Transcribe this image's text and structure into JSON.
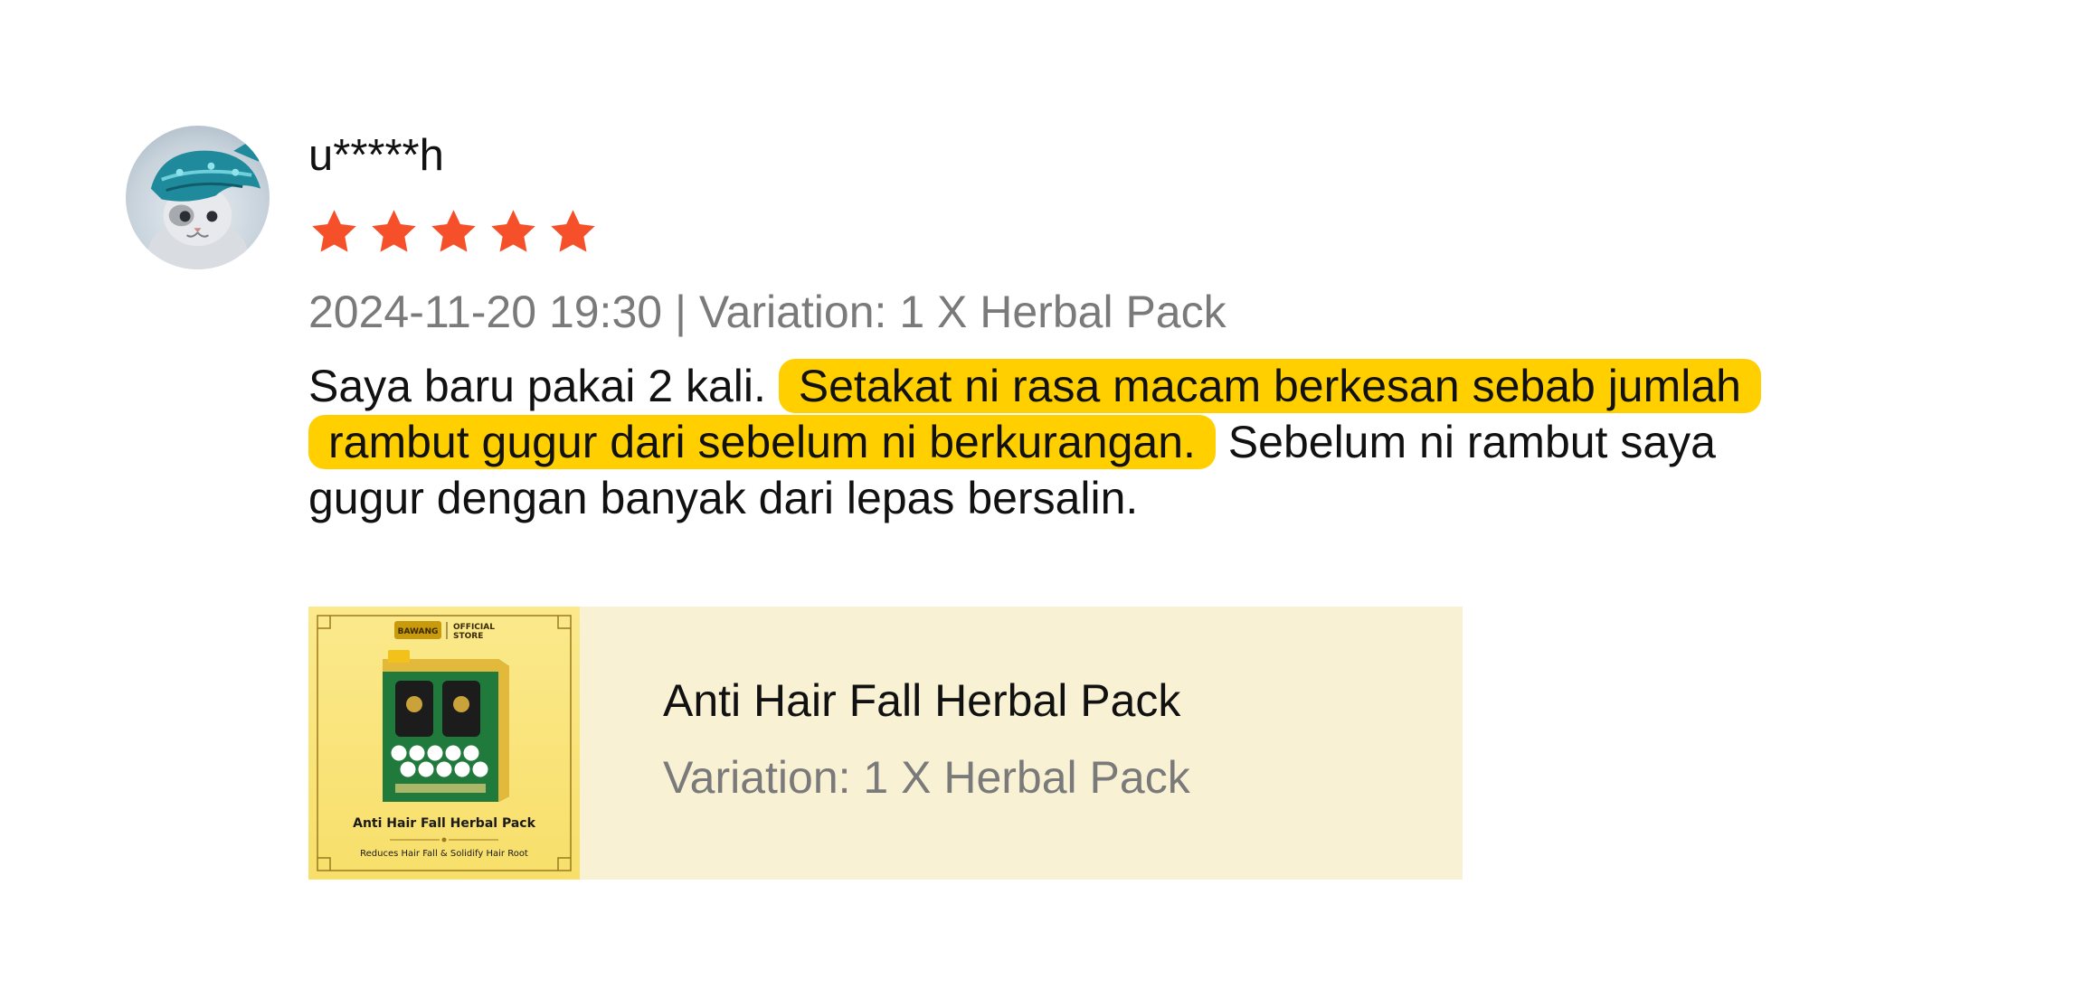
{
  "review": {
    "username": "u*****h",
    "rating": 5,
    "rating_max": 5,
    "star_color": "#f5502a",
    "date": "2024-11-20 19:30",
    "separator": "|",
    "variation_label": "Variation:",
    "variation_value": "1 X Herbal Pack",
    "text_before": "Saya baru pakai 2 kali.",
    "text_highlight": "Setakat ni rasa macam berkesan sebab jumlah rambut gugur dari sebelum ni berkurangan.",
    "text_after": "Sebelum ni rambut saya gugur dengan banyak dari lepas bersalin.",
    "highlight_color": "#ffcf00"
  },
  "product": {
    "title": "Anti Hair Fall Herbal Pack",
    "variation": "Variation: 1 X Herbal Pack",
    "thumb": {
      "brand": "BAWANG",
      "store_line1": "OFFICIAL",
      "store_line2": "STORE",
      "pack_title": "Anti Hair Fall Herbal Pack",
      "pack_subtitle": "Reduces Hair Fall & Solidify Hair Root"
    }
  }
}
